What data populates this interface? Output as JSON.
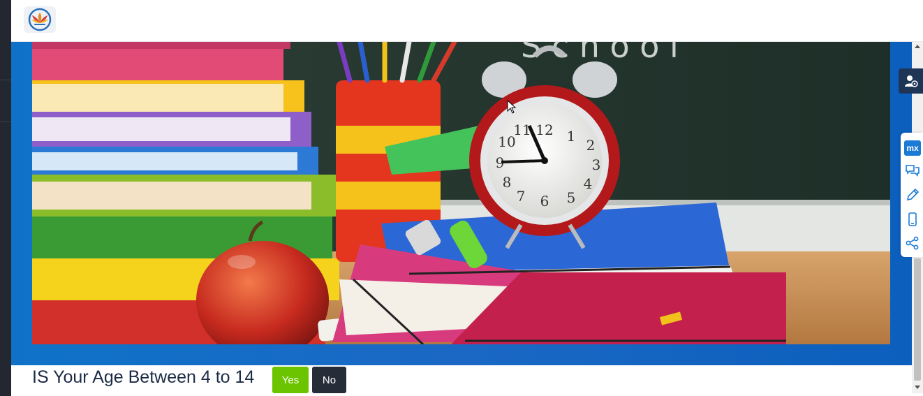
{
  "question": {
    "text": "IS Your Age Between 4 to 14",
    "yes_label": "Yes",
    "no_label": "No"
  },
  "sidebar_tools": {
    "mx_label": "mx",
    "icons": [
      "user-settings-icon",
      "mx-icon",
      "chat-icon",
      "pencil-icon",
      "mobile-icon",
      "share-icon"
    ]
  },
  "hero": {
    "image_subject": "school-supplies-photo",
    "clock_numerals": [
      "12",
      "1",
      "2",
      "3",
      "4",
      "5",
      "6",
      "7",
      "8",
      "9",
      "10",
      "11"
    ]
  },
  "colors": {
    "hero_blue": "#0f72c8",
    "yes_green": "#6cc300",
    "no_dark": "#262d38",
    "title_navy": "#1c2b45",
    "mx_blue": "#1a7ad6"
  }
}
